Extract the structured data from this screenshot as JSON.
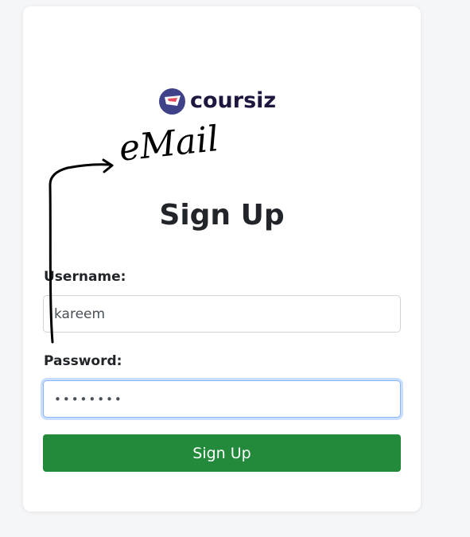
{
  "brand": {
    "name": "coursiz",
    "accent": "#3f4189",
    "text_color": "#1f1640"
  },
  "form": {
    "title": "Sign Up",
    "username": {
      "label": "Username:",
      "value": "kareem"
    },
    "password": {
      "label": "Password:",
      "value": "••••••••"
    },
    "submit_label": "Sign Up",
    "submit_color": "#228a3a"
  },
  "annotation": {
    "text": "eMail",
    "icon": "hand-drawn-arrow-icon"
  }
}
